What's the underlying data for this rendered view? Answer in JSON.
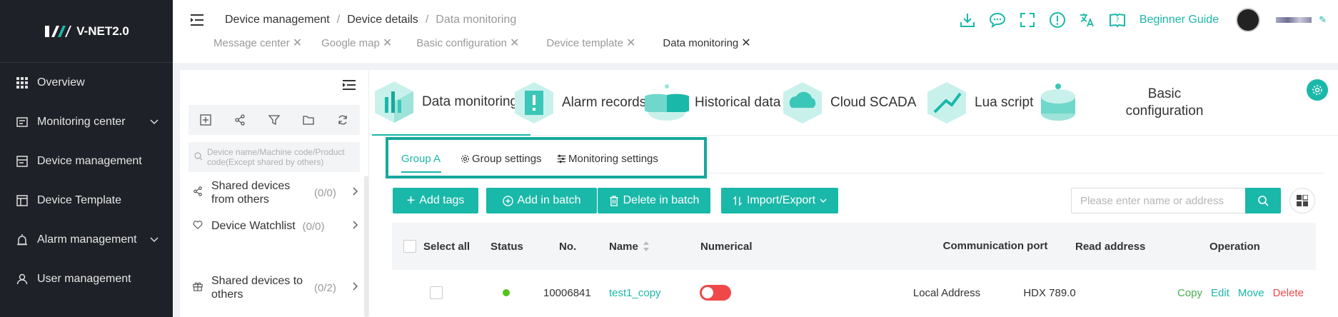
{
  "sidebar": {
    "logo": "V-NET2.0",
    "items": [
      {
        "label": "Overview",
        "icon": "grid-icon",
        "chevron": false
      },
      {
        "label": "Monitoring center",
        "icon": "monitor-icon",
        "chevron": true
      },
      {
        "label": "Device management",
        "icon": "device-icon",
        "chevron": false
      },
      {
        "label": "Device Template",
        "icon": "template-icon",
        "chevron": false
      },
      {
        "label": "Alarm management",
        "icon": "alarm-icon",
        "chevron": true
      },
      {
        "label": "User management",
        "icon": "user-icon",
        "chevron": false
      }
    ]
  },
  "header": {
    "breadcrumb": [
      "Device management",
      "Device details",
      "Data monitoring"
    ],
    "tabs": [
      {
        "label": "Message center",
        "active": false
      },
      {
        "label": "Google map",
        "active": false
      },
      {
        "label": "Basic configuration",
        "active": false
      },
      {
        "label": "Device template",
        "active": false
      },
      {
        "label": "Data monitoring",
        "active": true
      }
    ],
    "guide": "Beginner Guide"
  },
  "left_panel": {
    "search_placeholder": "Device name/Machine code/Product code(Except shared by others)",
    "items": [
      {
        "label": "Shared devices from others",
        "count": "(0/0)"
      },
      {
        "label": "Device Watchlist",
        "count": "(0/0)"
      },
      {
        "label": "Shared devices to others",
        "count": "(0/2)"
      }
    ]
  },
  "modules": [
    {
      "label": "Data monitoring",
      "active": true
    },
    {
      "label": "Alarm records",
      "active": false
    },
    {
      "label": "Historical data",
      "active": false
    },
    {
      "label": "Cloud SCADA",
      "active": false
    },
    {
      "label": "Lua script",
      "active": false
    },
    {
      "label": "Basic configuration",
      "active": false
    }
  ],
  "subtabs": {
    "group": "Group A",
    "group_settings": "Group settings",
    "monitoring_settings": "Monitoring settings"
  },
  "actions": {
    "add_tags": "Add tags",
    "add_batch": "Add in batch",
    "delete_batch": "Delete in batch",
    "import_export": "Import/Export",
    "search_placeholder": "Please enter name or address"
  },
  "table": {
    "headers": {
      "select_all": "Select all",
      "status": "Status",
      "no": "No.",
      "name": "Name",
      "numerical": "Numerical",
      "comm_port": "Communication port",
      "read_address": "Read address",
      "operation": "Operation"
    },
    "rows": [
      {
        "no": "10006841",
        "name": "test1_copy",
        "comm_port": "Local Address",
        "read_address": "HDX 789.0",
        "status_color": "#52c41a",
        "value_on": false
      }
    ],
    "ops": {
      "copy": "Copy",
      "edit": "Edit",
      "move": "Move",
      "delete": "Delete"
    }
  },
  "colors": {
    "accent": "#1ab8a8",
    "sidebar": "#1f2128",
    "danger": "#f04848",
    "copy": "#4caf50"
  }
}
